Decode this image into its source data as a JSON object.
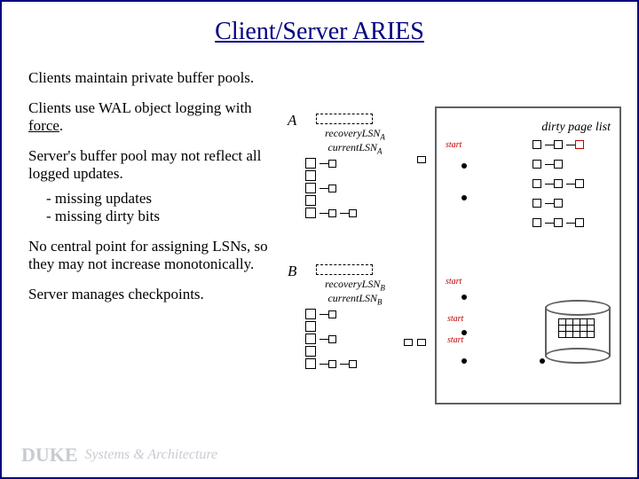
{
  "title": "Client/Server ARIES",
  "bullets": {
    "p1": "Clients maintain private buffer pools.",
    "p2a": "Clients use WAL object logging with ",
    "p2b": "force",
    "p2c": ".",
    "p3": "Server's buffer pool may not reflect all logged updates.",
    "sub1": "- missing updates",
    "sub2": "- missing dirty bits",
    "p4": "No central point for assigning LSNs, so they may not increase monotonically.",
    "p5": "Server manages checkpoints."
  },
  "clientA": {
    "label": "A",
    "rec": "recoveryLSN",
    "recSub": "A",
    "cur": "currentLSN",
    "curSub": "A"
  },
  "clientB": {
    "label": "B",
    "rec": "recoveryLSN",
    "recSub": "B",
    "cur": "currentLSN",
    "curSub": "B"
  },
  "server": {
    "dirty": "dirty page list",
    "start1": "start",
    "start2": "start",
    "start3": "start",
    "start4": "start"
  },
  "footer": {
    "duke": "DUKE",
    "sys": "Systems & Architecture"
  }
}
